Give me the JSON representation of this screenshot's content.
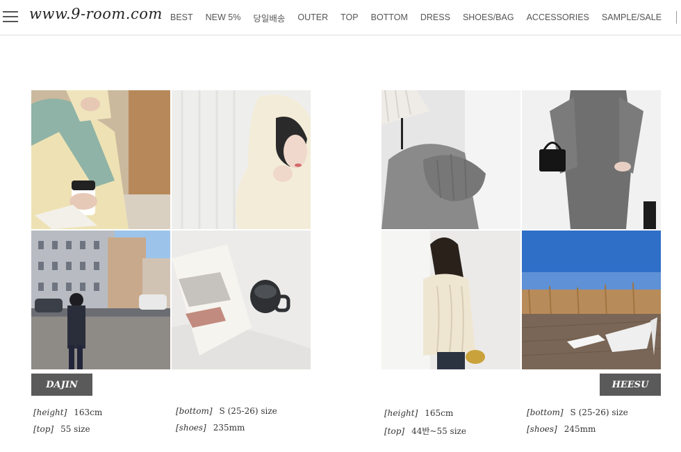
{
  "header": {
    "logo": "www.9-room.com",
    "nav": [
      "BEST",
      "NEW 5%",
      "당일배송",
      "OUTER",
      "TOP",
      "BOTTOM",
      "DRESS",
      "SHOES/BAG",
      "ACCESSORIES",
      "SAMPLE/SALE"
    ]
  },
  "models": [
    {
      "name": "DAJIN",
      "height_label": "[height]",
      "height": "163cm",
      "top_label": "[top]",
      "top": "55 size",
      "bottom_label": "[bottom]",
      "bottom": "S (25-26) size",
      "shoes_label": "[shoes]",
      "shoes": "235mm"
    },
    {
      "name": "HEESU",
      "height_label": "[height]",
      "height": "165cm",
      "top_label": "[top]",
      "top": "44반~55 size",
      "bottom_label": "[bottom]",
      "bottom": "S (25-26) size",
      "shoes_label": "[shoes]",
      "shoes": "245mm"
    }
  ],
  "colors": {
    "tag_bg": "#5a5a5a",
    "border": "#dcdcdc"
  }
}
